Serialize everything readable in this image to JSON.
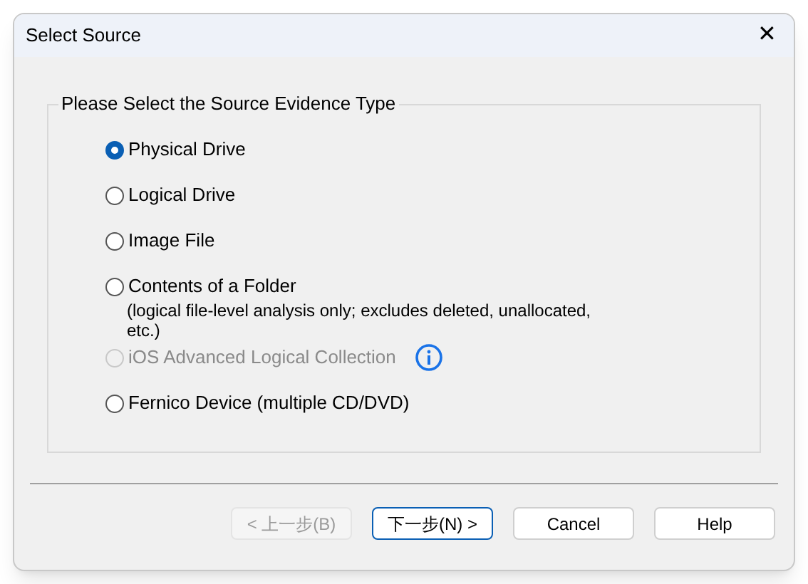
{
  "window": {
    "title": "Select Source",
    "close": "✕"
  },
  "group": {
    "title": "Please Select the Source Evidence Type",
    "options": [
      {
        "label": "Physical Drive",
        "selected": true,
        "disabled": false
      },
      {
        "label": "Logical Drive",
        "selected": false,
        "disabled": false
      },
      {
        "label": "Image File",
        "selected": false,
        "disabled": false
      },
      {
        "label": "Contents of a Folder",
        "selected": false,
        "disabled": false,
        "note": "(logical file-level analysis only; excludes deleted, unallocated, etc.)"
      },
      {
        "label": "iOS Advanced Logical Collection",
        "selected": false,
        "disabled": true,
        "info": true
      },
      {
        "label": "Fernico Device (multiple CD/DVD)",
        "selected": false,
        "disabled": false
      }
    ]
  },
  "buttons": [
    {
      "label": "< 上一步(B)",
      "disabled": true,
      "default": false
    },
    {
      "label": "下一步(N) >",
      "disabled": false,
      "default": true
    },
    {
      "label": "Cancel",
      "disabled": false,
      "default": false
    },
    {
      "label": "Help",
      "disabled": false,
      "default": false
    }
  ]
}
